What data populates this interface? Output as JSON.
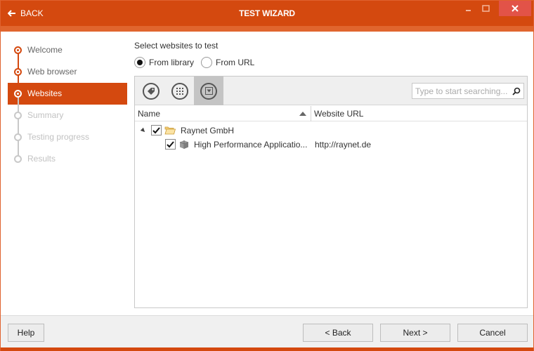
{
  "window": {
    "title": "TEST WIZARD",
    "back_label": "BACK",
    "accent_color": "#d4490f",
    "close_color": "#e25348"
  },
  "sidebar": {
    "steps": [
      {
        "label": "Welcome",
        "state": "done"
      },
      {
        "label": "Web browser",
        "state": "done"
      },
      {
        "label": "Websites",
        "state": "active"
      },
      {
        "label": "Summary",
        "state": "pending"
      },
      {
        "label": "Testing progress",
        "state": "pending"
      },
      {
        "label": "Results",
        "state": "pending"
      }
    ]
  },
  "main": {
    "section_label": "Select websites to test",
    "source_options": [
      {
        "label": "From library",
        "checked": true
      },
      {
        "label": "From URL",
        "checked": false
      }
    ],
    "toolbar": {
      "buttons": [
        {
          "icon": "tag-icon",
          "active": false
        },
        {
          "icon": "grid-icon",
          "active": false
        },
        {
          "icon": "filter-dropdown-icon",
          "active": true
        }
      ],
      "search_placeholder": "Type to start searching...",
      "search_value": ""
    },
    "grid": {
      "columns": [
        {
          "label": "Name",
          "sort": "ascending"
        },
        {
          "label": "Website URL"
        }
      ],
      "rows": [
        {
          "level": 0,
          "expanded": true,
          "checked": true,
          "icon": "folder-icon",
          "name": "Raynet GmbH",
          "url": ""
        },
        {
          "level": 1,
          "checked": true,
          "icon": "package-icon",
          "name": "High Performance Applicatio...",
          "url": "http://raynet.de"
        }
      ]
    }
  },
  "footer": {
    "help_label": "Help",
    "back_label": "< Back",
    "next_label": "Next >",
    "cancel_label": "Cancel"
  }
}
